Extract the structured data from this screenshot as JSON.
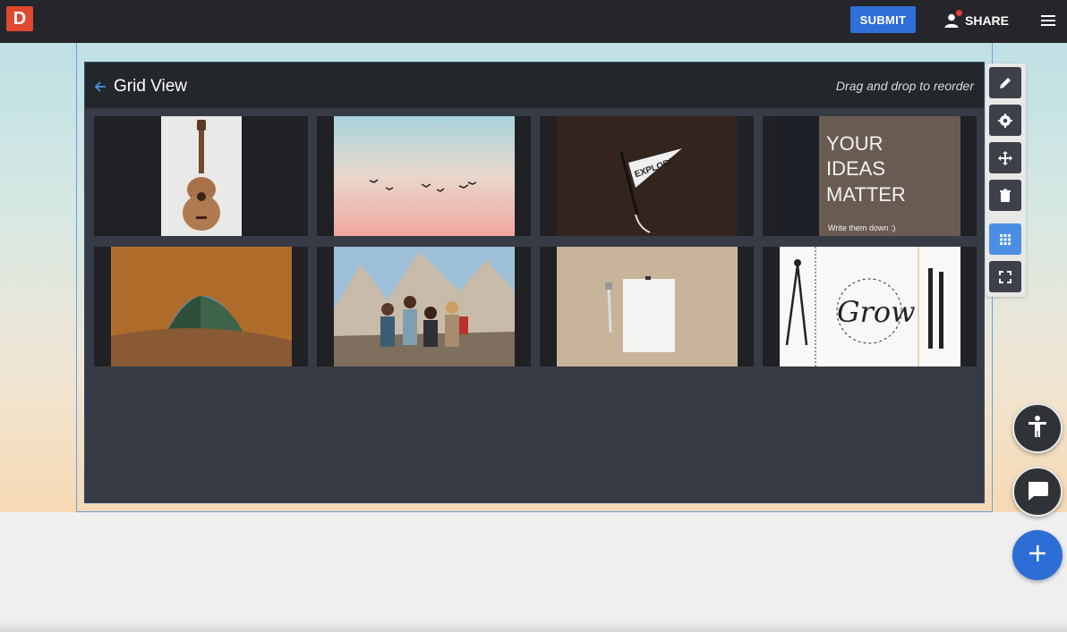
{
  "app": {
    "logo_letter": "D",
    "brand_color": "#e0482f",
    "accent_color": "#2f6fd8"
  },
  "topbar": {
    "submit_label": "SUBMIT",
    "share_label": "SHARE",
    "menu_icon": "hamburger-icon"
  },
  "panel": {
    "title": "Grid View",
    "hint": "Drag and drop to reorder",
    "back_icon": "arrow-left-icon"
  },
  "grid": {
    "images": [
      {
        "subject": "ukulele"
      },
      {
        "subject": "birds at sunset sky"
      },
      {
        "subject": "explore pennant"
      },
      {
        "subject": "your ideas matter sign"
      },
      {
        "subject": "tent view of forest"
      },
      {
        "subject": "hikers in mountains"
      },
      {
        "subject": "blank paper and pen"
      },
      {
        "subject": "grow drawing notebook"
      }
    ],
    "sign_text": [
      "YOUR",
      "IDEAS",
      "MATTER",
      "Write them down :)"
    ],
    "pennant_text": "EXPLORE",
    "drawing_text": "Grow"
  },
  "toolbar": {
    "tools": [
      "pencil-icon",
      "gear-icon",
      "move-icon",
      "trash-icon",
      "grid-icon",
      "fullscreen-icon"
    ],
    "active_tool": "grid-icon"
  },
  "fabs": [
    "accessibility-icon",
    "chat-icon",
    "plus-icon"
  ]
}
